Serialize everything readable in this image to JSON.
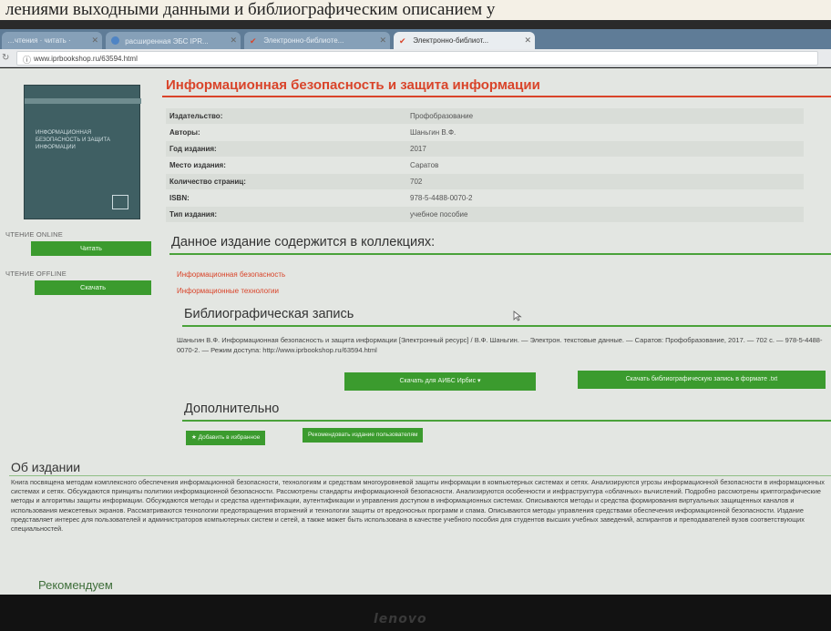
{
  "caption": "лениями выходными данными и библиографическим описанием у",
  "tabs": [
    {
      "label": "…чтения · читать ·"
    },
    {
      "label": "расширенная ЭБС IPR..."
    },
    {
      "label": "Электронно-библиоте..."
    },
    {
      "label": "Электронно-библиот..."
    }
  ],
  "url": "www.iprbookshop.ru/63594.html",
  "book": {
    "cover_title": "ИНФОРМАЦИОННАЯ БЕЗОПАСНОСТЬ И ЗАЩИТА ИНФОРМАЦИИ",
    "title": "Информационная безопасность и защита информации",
    "meta": [
      {
        "key": "Издательство:",
        "value": "Профобразование"
      },
      {
        "key": "Авторы:",
        "value": "Шаньгин В.Ф."
      },
      {
        "key": "Год издания:",
        "value": "2017"
      },
      {
        "key": "Место издания:",
        "value": "Саратов"
      },
      {
        "key": "Количество страниц:",
        "value": "702"
      },
      {
        "key": "ISBN:",
        "value": "978-5-4488-0070-2"
      },
      {
        "key": "Тип издания:",
        "value": "учебное пособие"
      }
    ]
  },
  "sidebar": {
    "online_label": "ЧТЕНИЕ ONLINE",
    "read_button": "Читать",
    "offline_label": "ЧТЕНИЕ OFFLINE",
    "download_button": "Скачать"
  },
  "collections": {
    "heading": "Данное издание содержится в коллекциях:",
    "items": [
      "Информационная безопасность",
      "Информационные технологии"
    ]
  },
  "bibliography": {
    "heading": "Библиографическая запись",
    "text": "Шаньгин В.Ф. Информационная безопасность и защита информации [Электронный ресурс] / В.Ф. Шаньгин. — Электрон. текстовые данные. — Саратов: Профобразование, 2017. — 702 c. — 978-5-4488-0070-2. — Режим доступа: http://www.iprbookshop.ru/63594.html",
    "button_irbis": "Скачать для АИБС Ирбис ▾",
    "button_txt": "Скачать библиографическую запись в формате .txt"
  },
  "additional": {
    "heading": "Дополнительно",
    "favorite_button": "★ Добавить в избранное",
    "recommend_button": "Рекомендовать издание пользователям"
  },
  "about": {
    "heading": "Об издании",
    "text": "Книга посвящена методам комплексного обеспечения информационной безопасности, технологиям и средствам многоуровневой защиты информации в компьютерных системах и сетях. Анализируются угрозы информационной безопасности в информационных системах и сетях. Обсуждаются принципы политики информационной безопасности. Рассмотрены стандарты информационной безопасности. Анализируются особенности и инфраструктура «облачных» вычислений. Подробно рассмотрены криптографические методы и алгоритмы защиты информации. Обсуждаются методы и средства идентификации, аутентификации и управления доступом в информационных системах. Описываются методы и средства формирования виртуальных защищенных каналов и использования межсетевых экранов. Рассматриваются технологии предотвращения вторжений и технологии защиты от вредоносных программ и спама. Описываются методы управления средствами обеспечения информационной безопасности. Издание представляет интерес для пользователей и администраторов компьютерных систем и сетей, а также может быть использована в качестве учебного пособия для студентов высших учебных заведений, аспирантов и преподавателей вузов соответствующих специальностей."
  },
  "recommend": {
    "heading": "Рекомендуем"
  },
  "brand": "lenovo",
  "colors": {
    "accent_red": "#d9442a",
    "button_green": "#3b9b2e",
    "rule_green": "#4aa23a"
  }
}
